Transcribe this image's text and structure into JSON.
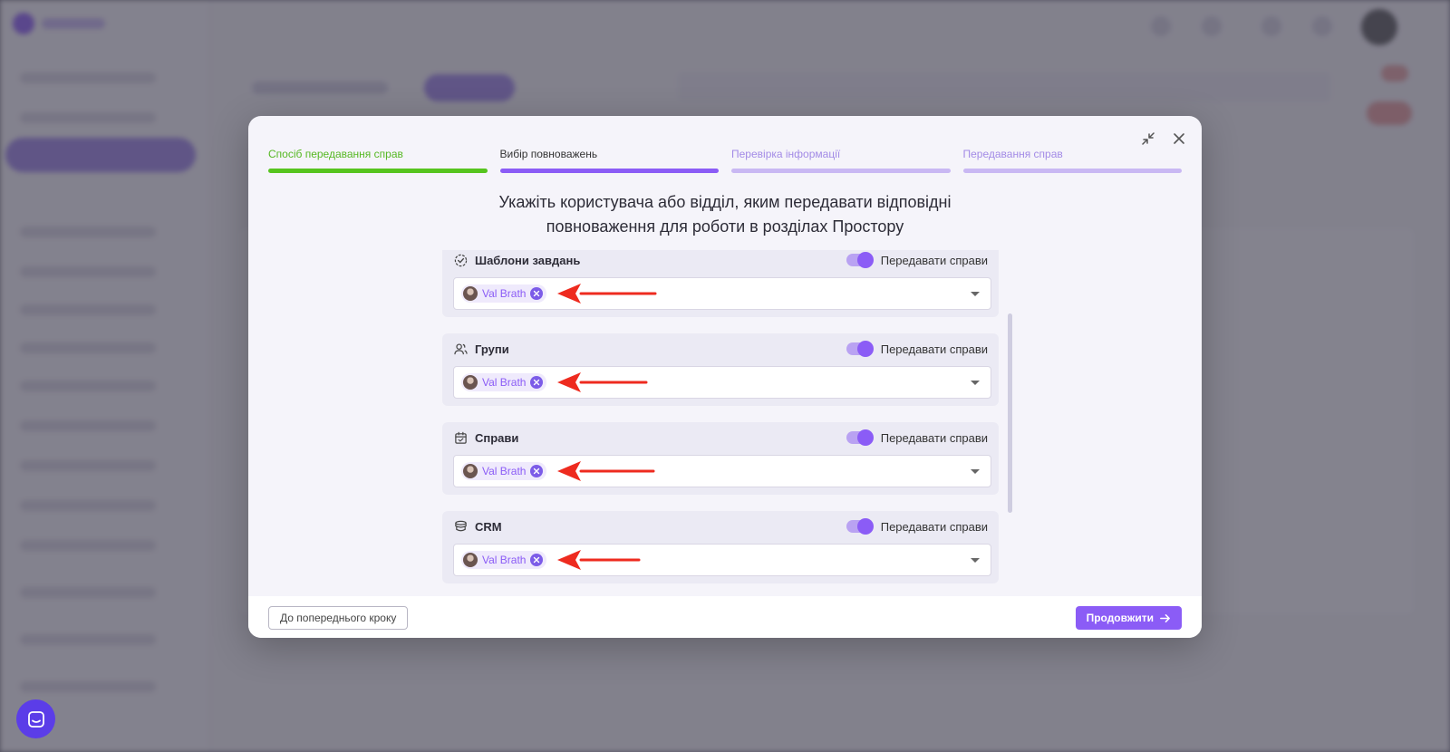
{
  "modal": {
    "steps": [
      {
        "label": "Спосіб передавання справ",
        "state": "done"
      },
      {
        "label": "Вибір повноважень",
        "state": "active"
      },
      {
        "label": "Перевірка інформації",
        "state": "todo"
      },
      {
        "label": "Передавання справ",
        "state": "todo"
      }
    ],
    "heading_line1": "Укажіть користувача або відділ, яким передавати відповідні",
    "heading_line2": "повноваження для роботи в розділах Простору",
    "sections": [
      {
        "title": "Шаблони завдань",
        "icon": "task-template-icon",
        "toggle_label": "Передавати справи",
        "toggle_on": true,
        "assignee": "Val Brath"
      },
      {
        "title": "Групи",
        "icon": "users-icon",
        "toggle_label": "Передавати справи",
        "toggle_on": true,
        "assignee": "Val Brath"
      },
      {
        "title": "Справи",
        "icon": "calendar-icon",
        "toggle_label": "Передавати справи",
        "toggle_on": true,
        "assignee": "Val Brath"
      },
      {
        "title": "CRM",
        "icon": "crm-database-icon",
        "toggle_label": "Передавати справи",
        "toggle_on": true,
        "assignee": "Val Brath"
      }
    ],
    "footer": {
      "back_label": "До попереднього кроку",
      "next_label": "Продовжити"
    }
  },
  "colors": {
    "accent": "#8b5cf6",
    "done": "#56c41e",
    "annotation_arrow": "#ee2b1f"
  }
}
